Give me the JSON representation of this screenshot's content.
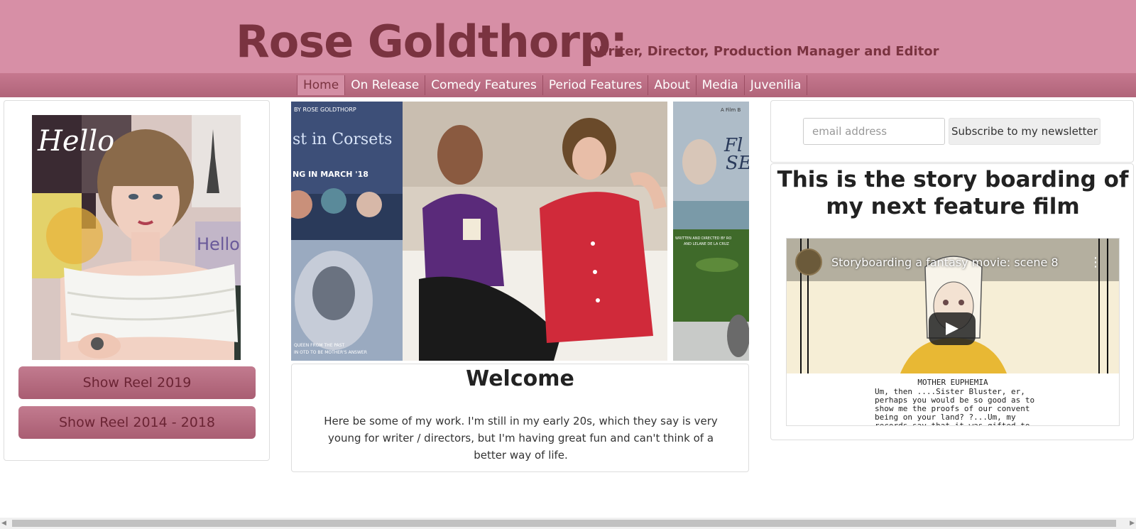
{
  "header": {
    "title": "Rose Goldthorp:",
    "subtitle": "Writer, Director, Production Manager and Editor"
  },
  "nav": {
    "items": [
      {
        "label": "Home",
        "active": true
      },
      {
        "label": "On Release"
      },
      {
        "label": "Comedy Features"
      },
      {
        "label": "Period Features"
      },
      {
        "label": "About"
      },
      {
        "label": "Media"
      },
      {
        "label": "Juvenilia"
      }
    ]
  },
  "left": {
    "photo_text": "Hello",
    "photo_text2": "Hello",
    "reel_2019": "Show Reel 2019",
    "reel_2014": "Show Reel 2014 - 2018"
  },
  "slider": {
    "poster1_byline": "BY ROSE GOLDTHORP",
    "poster1_title": "st in Corsets",
    "poster1_date": "NG IN MARCH '18",
    "poster1_tagline": "QUEEN FROM THE PAST",
    "poster1_tagline2": "IN OTD TO BE MOTHER'S ANSWER",
    "poster2_byline": "A Film B",
    "poster2_title": "Fl",
    "poster2_title2": "SE",
    "poster2_credits": "WRITTEN AND DIRECTED BY RO",
    "poster2_credits2": "AND LELANE DE LA CRUZ"
  },
  "welcome": {
    "title": "Welcome",
    "text": "Here be some of my work. I'm still in my early 20s, which they say is very young for writer / directors, but I'm having great fun and can't think of a better way of life."
  },
  "newsletter": {
    "email_placeholder": "email address",
    "subscribe_label": "Subscribe to my newsletter"
  },
  "story": {
    "heading": "This is the story boarding of my next feature film",
    "video_title": "Storyboarding a fantasy movie: scene 8",
    "script_character": "MOTHER EUPHEMIA",
    "script_lines": "Um, then ....Sister Bluster, er,\nperhaps you would be so good as to\nshow me the proofs of our convent\nbeing on your land? ?...Um, my\nrecords say that it was gifted to"
  },
  "colors": {
    "header_bg": "#d78fa6",
    "title_color": "#7a3340",
    "nav_bg": "#b06479",
    "button_bg": "#b56a7f"
  },
  "icons": {
    "play": "play-icon",
    "more": "more-vertical-icon",
    "scroll_left": "arrow-left-icon",
    "scroll_right": "arrow-right-icon"
  }
}
